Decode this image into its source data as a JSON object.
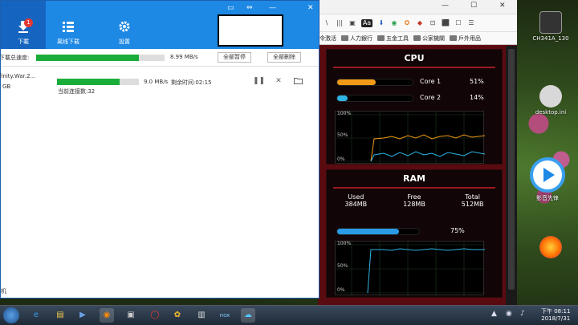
{
  "desktop": {
    "icons": [
      {
        "label": "CH341A_130",
        "color": "#444"
      },
      {
        "label": "desktop.ini",
        "color": "#888"
      },
      {
        "label": "影音先锋",
        "color": "#1e88e5"
      },
      {
        "label": "",
        "color": "#ff6a00"
      }
    ]
  },
  "browser": {
    "window_controls": [
      "—",
      "☐",
      "✕"
    ],
    "toolbar_icons": [
      "\\",
      "|||",
      "▣",
      "Aa",
      "⬇",
      "◉",
      "✪",
      "◆",
      "⊡",
      "⬛",
      "☐",
      "☰"
    ],
    "bookmarks": [
      {
        "label": "令激活",
        "folder": false
      },
      {
        "label": "人力銀行",
        "folder": true
      },
      {
        "label": "五金工具",
        "folder": true
      },
      {
        "label": "公家機關",
        "folder": true
      },
      {
        "label": "戶外用品",
        "folder": true
      }
    ],
    "cpu": {
      "title": "CPU",
      "cores": [
        {
          "label": "Core 1",
          "percent": 51,
          "pct_text": "51%",
          "color": "#f29a17"
        },
        {
          "label": "Core 2",
          "percent": 14,
          "pct_text": "14%",
          "color": "#2fb4e6"
        }
      ],
      "graph_labels": [
        "100%",
        "50%",
        "0%"
      ]
    },
    "ram": {
      "title": "RAM",
      "used_label": "Used",
      "used_value": "384MB",
      "free_label": "Free",
      "free_value": "128MB",
      "total_label": "Total",
      "total_value": "512MB",
      "percent": 75,
      "pct_text": "75%",
      "graph_labels": [
        "100%",
        "50%",
        "0%"
      ]
    }
  },
  "dm": {
    "nav": [
      {
        "label": "下載",
        "icon": "download-icon"
      },
      {
        "label": "离线下载",
        "icon": "list-icon"
      },
      {
        "label": "設置",
        "icon": "gear-icon"
      }
    ],
    "badge": "1",
    "window_controls": [
      "▭",
      "⇔",
      "—",
      "✕"
    ],
    "speed_label": "下載总速度:",
    "speed_value": "8.99 MB/s",
    "speed_percent": 80,
    "pause_all": "全部暂停",
    "delete_all": "全部刪除",
    "task": {
      "name": "finity.War.2...",
      "size": "GB",
      "speed": "9.0 MB/s",
      "remaining": "剩余时间:02:15",
      "connections": "当前连接数:32",
      "progress": 76
    },
    "bottom_text": "机"
  },
  "taskbar": {
    "apps": [
      "e",
      "▤",
      "▶",
      "◉",
      "▣",
      "◯",
      "✿",
      "▥",
      "nox",
      "☁"
    ],
    "tray": [
      "▲",
      "◉",
      "♪"
    ],
    "time": "下午 08:11",
    "date": "2018/7/31"
  }
}
